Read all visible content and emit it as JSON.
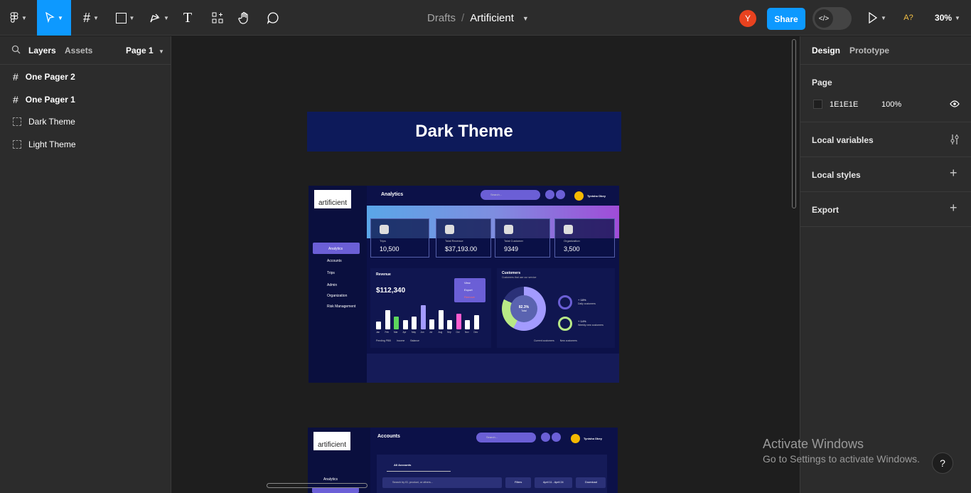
{
  "toolbar": {
    "breadcrumb_parent": "Drafts",
    "breadcrumb_sep": "/",
    "file_name": "Artificient",
    "avatar_initial": "Y",
    "share_label": "Share",
    "a11y_label": "A?",
    "zoom": "30%"
  },
  "left_panel": {
    "tab_layers": "Layers",
    "tab_assets": "Assets",
    "page_selector": "Page 1",
    "layers": [
      "One Pager 2",
      "One Pager 1",
      "Dark Theme",
      "Light Theme"
    ]
  },
  "right_panel": {
    "tab_design": "Design",
    "tab_prototype": "Prototype",
    "page_title": "Page",
    "page_color": "1E1E1E",
    "page_opacity": "100%",
    "local_variables": "Local variables",
    "local_styles": "Local styles",
    "export": "Export"
  },
  "canvas": {
    "frame_title": "Dark Theme",
    "dashboard1": {
      "logo_text": "artificient",
      "header_title": "Analytics",
      "search_placeholder": "Search...",
      "user_name": "Tynisha Obey",
      "nav_items": [
        "Analytics",
        "Accounts",
        "Trips",
        "Admin",
        "Organization",
        "Risk Management"
      ],
      "stats": [
        {
          "label": "Trips",
          "value": "10,500"
        },
        {
          "label": "Total Revenue",
          "value": "$37,193.00"
        },
        {
          "label": "Total Customer",
          "value": "9349"
        },
        {
          "label": "Organization",
          "value": "3,500"
        }
      ],
      "revenue_title": "Revenue",
      "revenue_value": "$112,340",
      "revenue_menu": [
        "View",
        "Export",
        "Remove"
      ],
      "bar_heights": [
        0.3,
        0.75,
        0.5,
        0.35,
        0.5,
        0.95,
        0.4,
        0.75,
        0.35,
        0.6,
        0.35,
        0.55
      ],
      "bar_colors": [
        "#ffffff",
        "#ffffff",
        "#5cd65c",
        "#ffffff",
        "#ffffff",
        "#a39bff",
        "#ffffff",
        "#ffffff",
        "#ffffff",
        "#ff5ccf",
        "#ffffff",
        "#ffffff"
      ],
      "months": [
        "Jan",
        "Feb",
        "Mar",
        "Apr",
        "May",
        "Jun",
        "Jul",
        "Aug",
        "Sep",
        "Oct",
        "Nov",
        "Dec"
      ],
      "revenue_legend": [
        "Pending PBB",
        "Income",
        "Balance"
      ],
      "customers_title": "Customers",
      "customers_sub": "Customers that use our service",
      "donut_pct": "82.3%",
      "donut_label": "Total",
      "daily_pct": "+ 18%",
      "daily_label": "Daily customers",
      "weekly_pct": "+ 14%",
      "weekly_label": "Weekly new customers",
      "customers_legend": [
        "Current customers",
        "New customers"
      ]
    },
    "dashboard2": {
      "logo_text": "artificient",
      "header_title": "Accounts",
      "search_placeholder": "Search...",
      "user_name": "Tynisha Obey",
      "tab": "All Accounts",
      "filter_placeholder": "Search by ID, product, or others...",
      "filters_label": "Filters",
      "date_label": "April 11 - April 24",
      "download_label": "Download",
      "nav_first": "Analytics"
    }
  },
  "watermark": {
    "title": "Activate Windows",
    "sub": "Go to Settings to activate Windows."
  }
}
